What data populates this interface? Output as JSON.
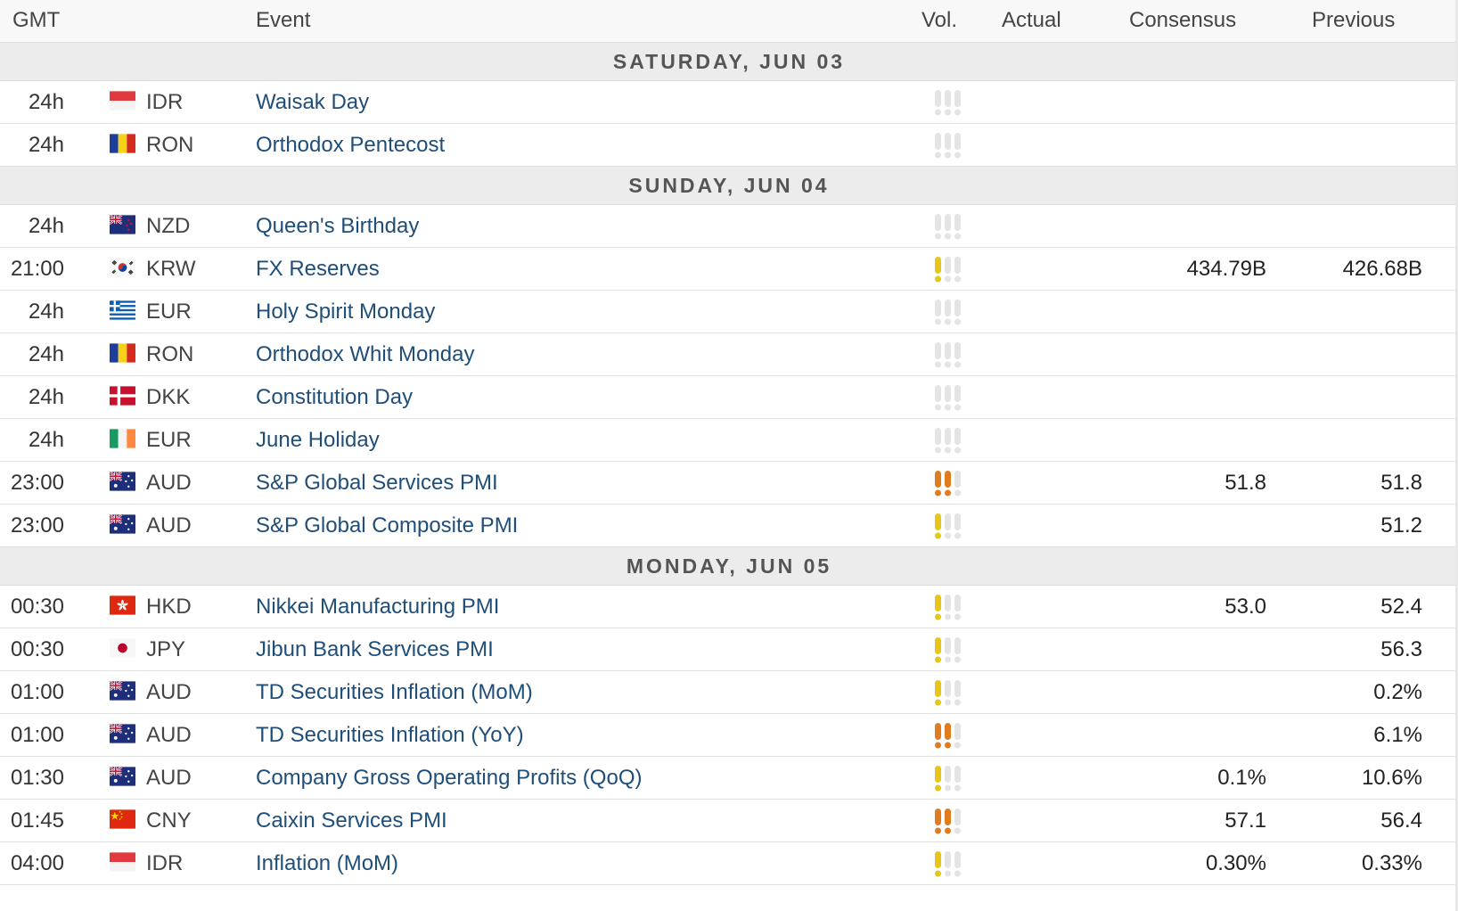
{
  "header": {
    "gmt": "GMT",
    "event": "Event",
    "vol": "Vol.",
    "actual": "Actual",
    "consensus": "Consensus",
    "previous": "Previous"
  },
  "colors": {
    "vol_high": "#e07b1e",
    "vol_medium": "#e6c619",
    "vol_off": "#e4e4e4",
    "event_link": "#1f4e79"
  },
  "days": [
    {
      "label": "SATURDAY, JUN 03",
      "events": [
        {
          "time": "24h",
          "flag": "id-flag-icon",
          "currency": "IDR",
          "event": "Waisak Day",
          "volatility": 0,
          "actual": "",
          "consensus": "",
          "previous": ""
        },
        {
          "time": "24h",
          "flag": "ro-flag-icon",
          "currency": "RON",
          "event": "Orthodox Pentecost",
          "volatility": 0,
          "actual": "",
          "consensus": "",
          "previous": ""
        }
      ]
    },
    {
      "label": "SUNDAY, JUN 04",
      "events": [
        {
          "time": "24h",
          "flag": "nz-flag-icon",
          "currency": "NZD",
          "event": "Queen's Birthday",
          "volatility": 0,
          "actual": "",
          "consensus": "",
          "previous": ""
        },
        {
          "time": "21:00",
          "flag": "kr-flag-icon",
          "currency": "KRW",
          "event": "FX Reserves",
          "volatility": 1,
          "actual": "",
          "consensus": "434.79B",
          "previous": "426.68B"
        },
        {
          "time": "24h",
          "flag": "gr-flag-icon",
          "currency": "EUR",
          "event": "Holy Spirit Monday",
          "volatility": 0,
          "actual": "",
          "consensus": "",
          "previous": ""
        },
        {
          "time": "24h",
          "flag": "ro-flag-icon",
          "currency": "RON",
          "event": "Orthodox Whit Monday",
          "volatility": 0,
          "actual": "",
          "consensus": "",
          "previous": ""
        },
        {
          "time": "24h",
          "flag": "dk-flag-icon",
          "currency": "DKK",
          "event": "Constitution Day",
          "volatility": 0,
          "actual": "",
          "consensus": "",
          "previous": ""
        },
        {
          "time": "24h",
          "flag": "ie-flag-icon",
          "currency": "EUR",
          "event": "June Holiday",
          "volatility": 0,
          "actual": "",
          "consensus": "",
          "previous": ""
        },
        {
          "time": "23:00",
          "flag": "au-flag-icon",
          "currency": "AUD",
          "event": "S&P Global Services PMI",
          "volatility": 2,
          "actual": "",
          "consensus": "51.8",
          "previous": "51.8"
        },
        {
          "time": "23:00",
          "flag": "au-flag-icon",
          "currency": "AUD",
          "event": "S&P Global Composite PMI",
          "volatility": 1,
          "actual": "",
          "consensus": "",
          "previous": "51.2"
        }
      ]
    },
    {
      "label": "MONDAY, JUN 05",
      "events": [
        {
          "time": "00:30",
          "flag": "hk-flag-icon",
          "currency": "HKD",
          "event": "Nikkei Manufacturing PMI",
          "volatility": 1,
          "actual": "",
          "consensus": "53.0",
          "previous": "52.4"
        },
        {
          "time": "00:30",
          "flag": "jp-flag-icon",
          "currency": "JPY",
          "event": "Jibun Bank Services PMI",
          "volatility": 1,
          "actual": "",
          "consensus": "",
          "previous": "56.3"
        },
        {
          "time": "01:00",
          "flag": "au-flag-icon",
          "currency": "AUD",
          "event": "TD Securities Inflation (MoM)",
          "volatility": 1,
          "actual": "",
          "consensus": "",
          "previous": "0.2%"
        },
        {
          "time": "01:00",
          "flag": "au-flag-icon",
          "currency": "AUD",
          "event": "TD Securities Inflation (YoY)",
          "volatility": 2,
          "actual": "",
          "consensus": "",
          "previous": "6.1%"
        },
        {
          "time": "01:30",
          "flag": "au-flag-icon",
          "currency": "AUD",
          "event": "Company Gross Operating Profits (QoQ)",
          "volatility": 1,
          "actual": "",
          "consensus": "0.1%",
          "previous": "10.6%"
        },
        {
          "time": "01:45",
          "flag": "cn-flag-icon",
          "currency": "CNY",
          "event": "Caixin Services PMI",
          "volatility": 2,
          "actual": "",
          "consensus": "57.1",
          "previous": "56.4"
        },
        {
          "time": "04:00",
          "flag": "id-flag-icon",
          "currency": "IDR",
          "event": "Inflation (MoM)",
          "volatility": 1,
          "actual": "",
          "consensus": "0.30%",
          "previous": "0.33%"
        }
      ]
    }
  ]
}
